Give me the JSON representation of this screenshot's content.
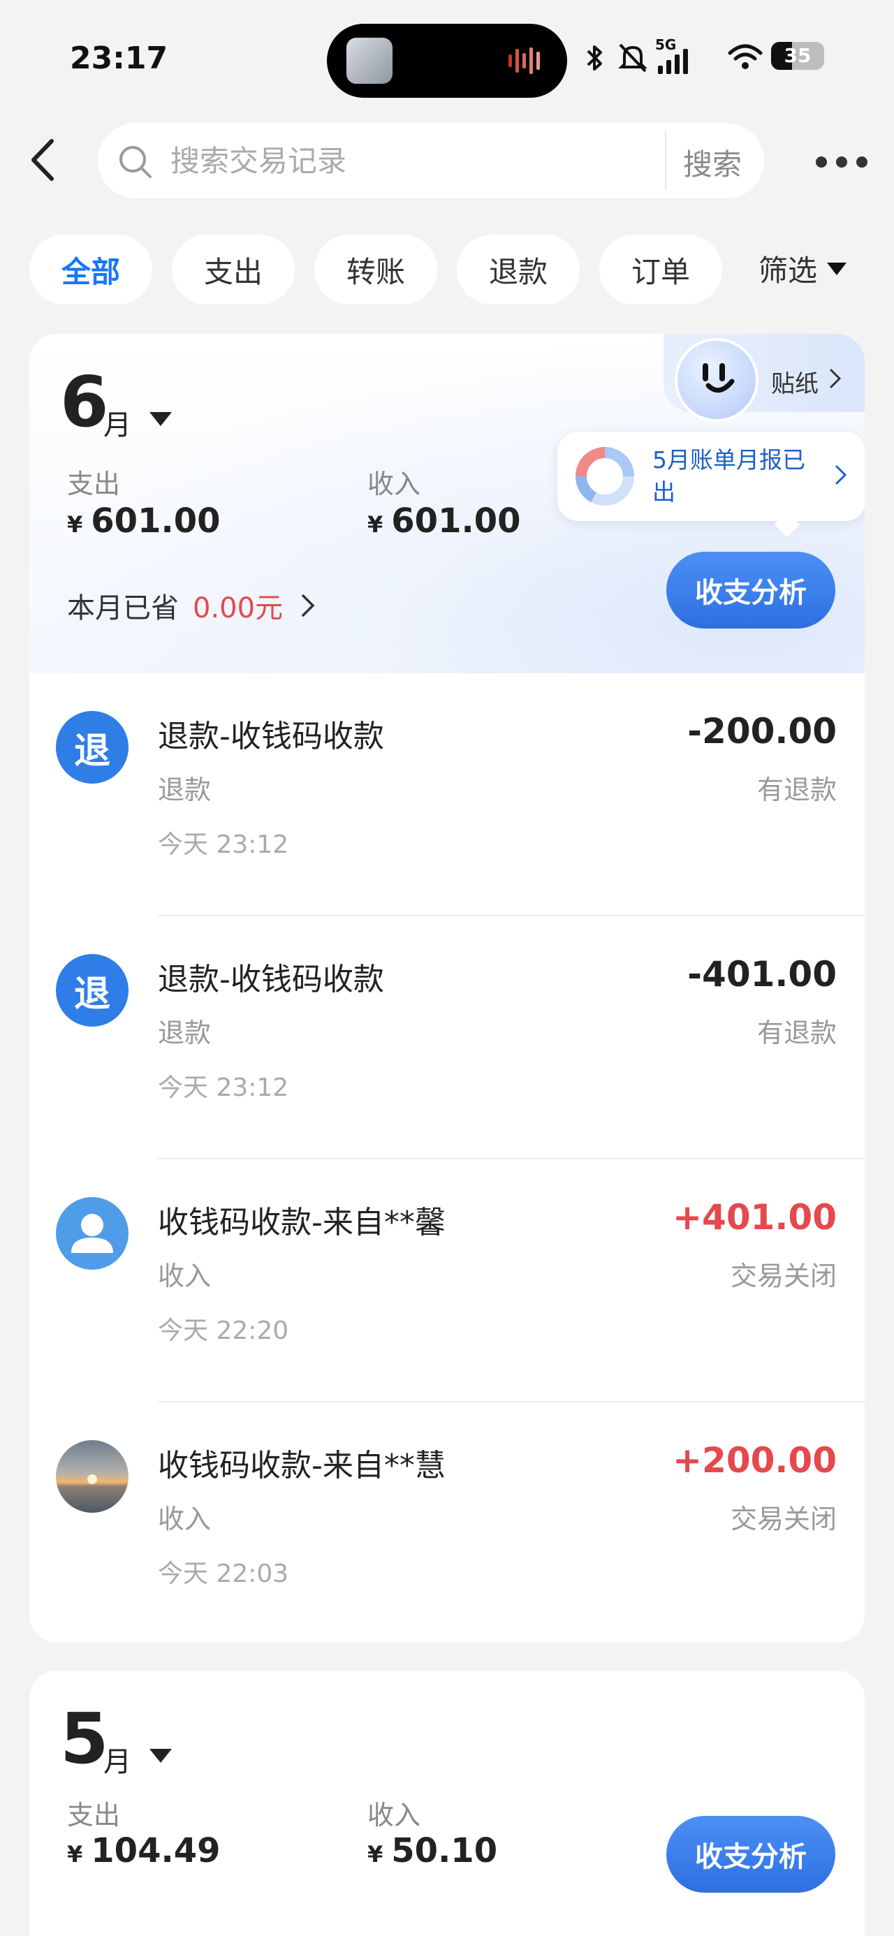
{
  "status_bar": {
    "time": "23:17",
    "network": "5G",
    "battery": "35"
  },
  "search": {
    "placeholder": "搜索交易记录",
    "button_label": "搜索"
  },
  "filters": {
    "chips": [
      "全部",
      "支出",
      "转账",
      "退款",
      "订单"
    ],
    "active": "全部",
    "filter_label": "筛选"
  },
  "june": {
    "month_number": "6",
    "month_unit": "月",
    "expense_label": "支出",
    "expense_currency": "¥",
    "expense_value": "601.00",
    "income_label": "收入",
    "income_currency": "¥",
    "income_value": "601.00",
    "saved_label": "本月已省",
    "saved_amount": "0.00元",
    "analysis_button": "收支分析",
    "sticker_label": "贴纸",
    "bubble_text": "5月账单月报已出"
  },
  "transactions": [
    {
      "title": "退款-收钱码收款",
      "icon_text": "退",
      "icon": "refund-icon",
      "category": "退款",
      "time": "今天 23:12",
      "amount": "-200.00",
      "status": "有退款"
    },
    {
      "title": "退款-收钱码收款",
      "icon_text": "退",
      "icon": "refund-icon",
      "category": "退款",
      "time": "今天 23:12",
      "amount": "-401.00",
      "status": "有退款"
    },
    {
      "title": "收钱码收款-来自**馨",
      "icon": "user-avatar-icon",
      "category": "收入",
      "time": "今天 22:20",
      "amount": "+401.00",
      "status": "交易关闭"
    },
    {
      "title": "收钱码收款-来自**慧",
      "icon": "sunset-photo-avatar",
      "category": "收入",
      "time": "今天 22:03",
      "amount": "+200.00",
      "status": "交易关闭"
    }
  ],
  "may": {
    "month_number": "5",
    "month_unit": "月",
    "expense_label": "支出",
    "expense_currency": "¥",
    "expense_value": "104.49",
    "income_label": "收入",
    "income_currency": "¥",
    "income_value": "50.10",
    "analysis_button": "收支分析"
  },
  "colors": {
    "accent_blue": "#1677ff",
    "income_red": "#e5484d",
    "background": "#f3f3f3"
  }
}
